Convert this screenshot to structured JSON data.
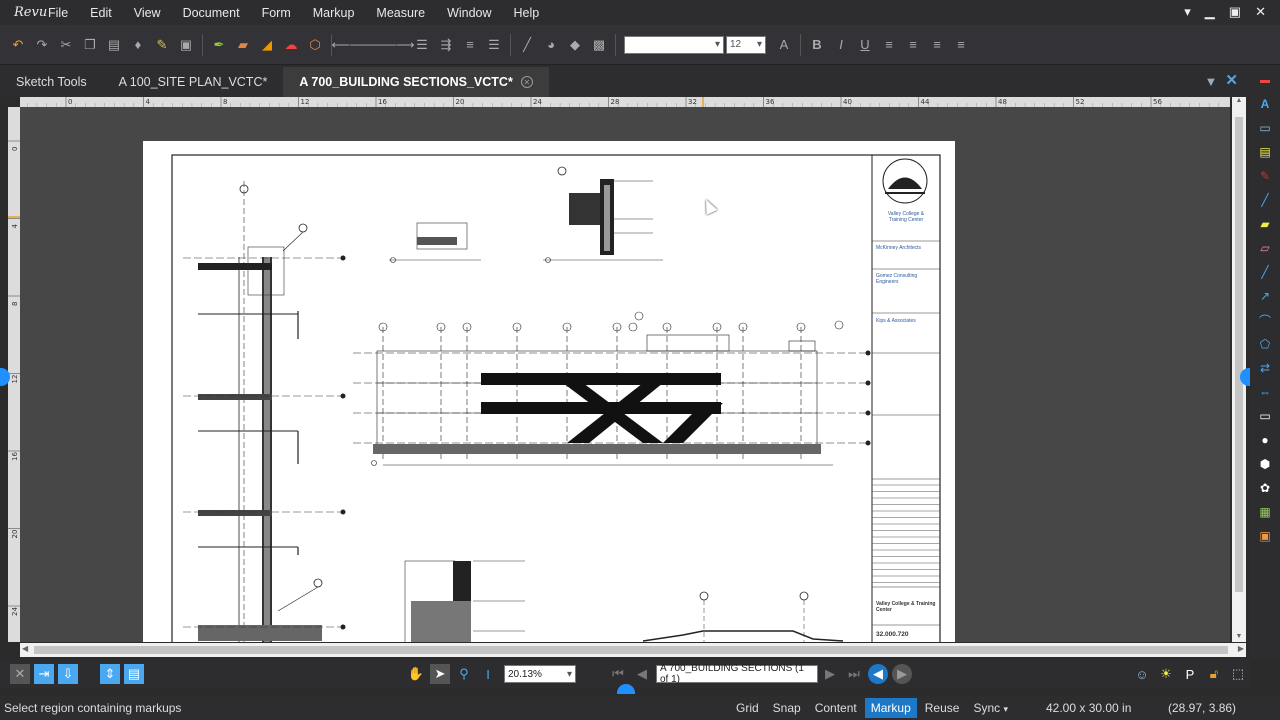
{
  "app": {
    "logo": "Revu"
  },
  "menu": [
    "File",
    "Edit",
    "View",
    "Document",
    "Form",
    "Markup",
    "Measure",
    "Window",
    "Help"
  ],
  "toolbar": {
    "font_size": "12"
  },
  "tabs": [
    {
      "label": "Sketch Tools",
      "active": false
    },
    {
      "label": "A 100_SITE PLAN_VCTC*",
      "active": false
    },
    {
      "label": "A 700_BUILDING SECTIONS_VCTC*",
      "active": true
    }
  ],
  "ruler": {
    "top_ticks": [
      "4",
      "0",
      "4",
      "8",
      "12",
      "16",
      "20",
      "24",
      "28",
      "32",
      "36",
      "40",
      "44",
      "48",
      "52",
      "56"
    ],
    "left_ticks": [
      "0",
      "4",
      "8",
      "12",
      "16",
      "20",
      "24"
    ]
  },
  "title_block": {
    "client": "Valley College & Training Center",
    "architect": "McKinney Architects",
    "engineers": "Gomez Consulting Engineers",
    "associates": "Kips & Associates",
    "project_name": "Valley College & Training Center",
    "sheet_number": "32.000.720"
  },
  "nav": {
    "zoom": "20.13%",
    "page_label": "A 700_BUILDING SECTIONS (1 of 1)"
  },
  "status": {
    "message": "Select region containing markups",
    "toggles": [
      {
        "label": "Grid",
        "on": false
      },
      {
        "label": "Snap",
        "on": false
      },
      {
        "label": "Content",
        "on": false
      },
      {
        "label": "Markup",
        "on": true
      },
      {
        "label": "Reuse",
        "on": false
      },
      {
        "label": "Sync",
        "on": false
      }
    ],
    "page_size": "42.00 x 30.00 in",
    "coords": "(28.97, 3.86)"
  },
  "colors": {
    "accent": "#1e78c8",
    "background": "#474747",
    "chrome": "#2d2d30"
  }
}
